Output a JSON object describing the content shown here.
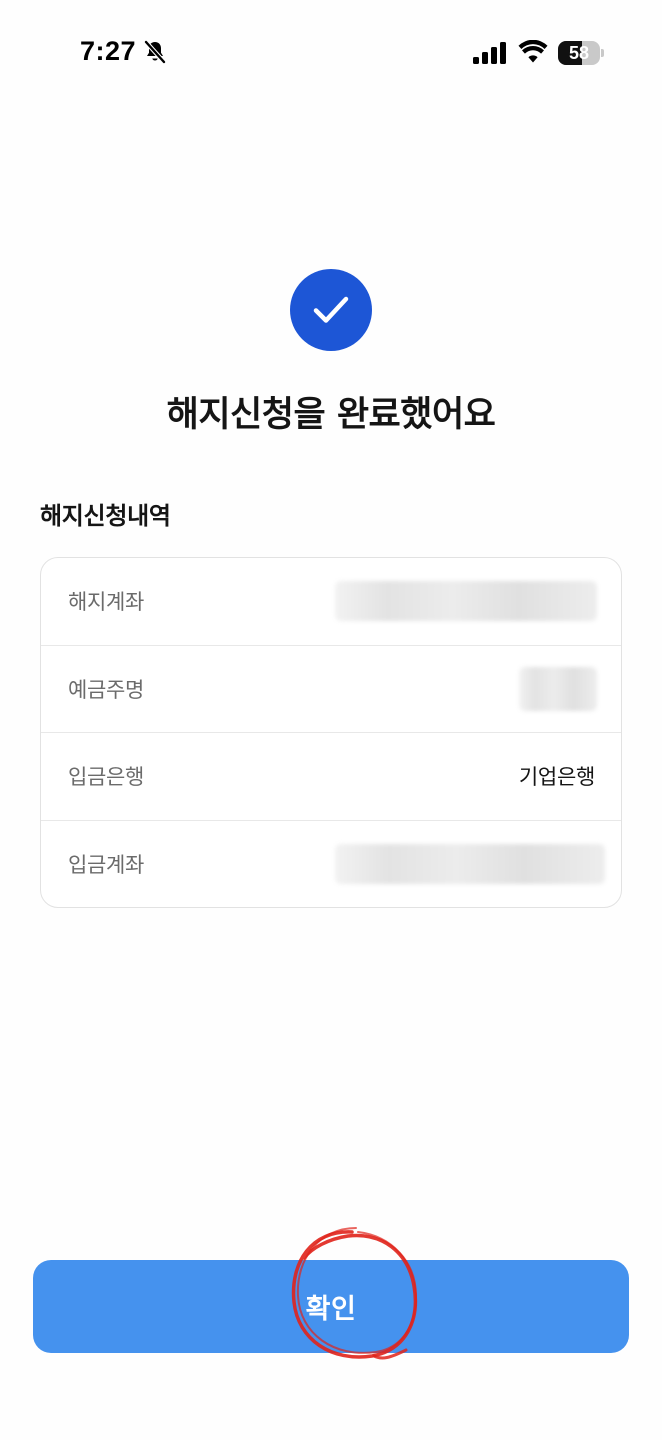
{
  "status_bar": {
    "time": "7:27",
    "battery_level": "58",
    "battery_fraction": 0.58,
    "icons": [
      "bell-slash-icon",
      "cellular-signal-icon",
      "wifi-icon",
      "battery-icon"
    ]
  },
  "success": {
    "icon": "checkmark-icon",
    "title": "해지신청을 완료했어요",
    "accent_color": "#1d56d6"
  },
  "details": {
    "section_title": "해지신청내역",
    "rows": [
      {
        "label": "해지계좌",
        "value": "",
        "masked": true
      },
      {
        "label": "예금주명",
        "value": "",
        "masked": true
      },
      {
        "label": "입금은행",
        "value": "기업은행",
        "masked": false
      },
      {
        "label": "입금계좌",
        "value": "",
        "masked": true
      }
    ]
  },
  "confirm": {
    "label": "확인",
    "color": "#4592ee"
  },
  "annotation": {
    "type": "hand-drawn-circle",
    "color": "#e0241b"
  }
}
